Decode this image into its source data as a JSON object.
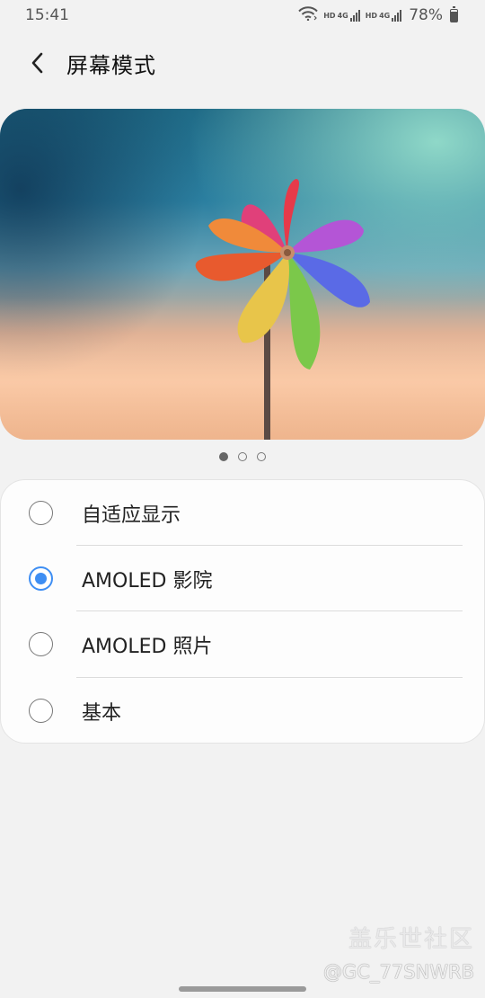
{
  "status_bar": {
    "time": "15:41",
    "hd1": "HD",
    "net1": "4G",
    "hd2": "HD",
    "net2": "4G",
    "battery": "78%",
    "icons": [
      "wifi-icon",
      "signal-icon",
      "battery-icon"
    ]
  },
  "header": {
    "title": "屏幕模式",
    "back_icon": "chevron-left-icon"
  },
  "preview": {
    "image": "pinwheel-photo",
    "page_count": 3,
    "active_page": 1
  },
  "options": [
    {
      "label": "自适应显示",
      "selected": false
    },
    {
      "label": "AMOLED 影院",
      "selected": true
    },
    {
      "label": "AMOLED 照片",
      "selected": false
    },
    {
      "label": "基本",
      "selected": false
    }
  ],
  "watermark": {
    "line1": "盖乐世社区",
    "line2": "@GC_77SNWRB"
  },
  "colors": {
    "accent": "#3e8ef3",
    "background": "#f2f2f2",
    "card": "#fdfdfd"
  }
}
